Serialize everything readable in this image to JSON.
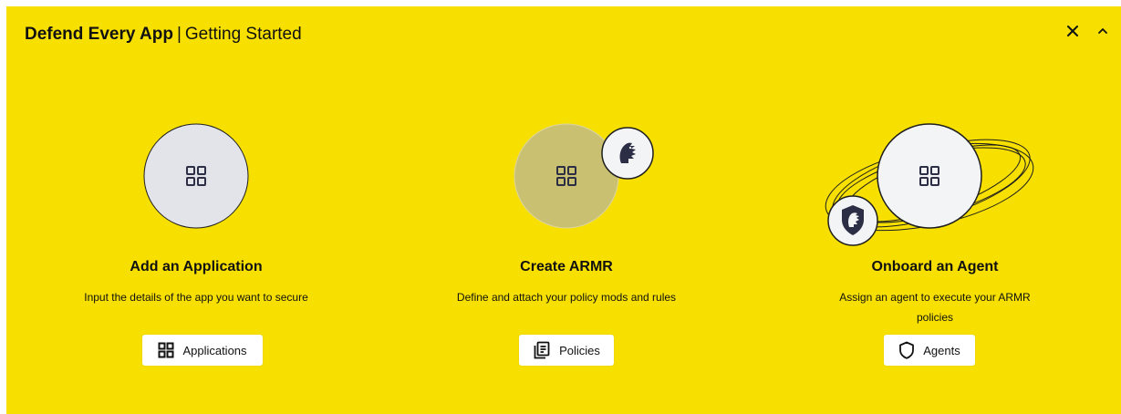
{
  "header": {
    "title_bold": "Defend Every App",
    "separator": "|",
    "title_light": "Getting Started"
  },
  "colors": {
    "panel_bg": "#f7e000",
    "circle_light": "#e2e4ea",
    "circle_olive": "#c9c072",
    "circle_white": "#f3f4f6",
    "dark_icon": "#2b2e45"
  },
  "cards": [
    {
      "title": "Add an Application",
      "description": "Input the details of the app you want to secure",
      "button_label": "Applications",
      "button_icon": "grid-icon"
    },
    {
      "title": "Create ARMR",
      "description": "Define and attach your policy mods and rules",
      "button_label": "Policies",
      "button_icon": "document-list-icon"
    },
    {
      "title": "Onboard an Agent",
      "description": "Assign an agent to execute your ARMR policies",
      "button_label": "Agents",
      "button_icon": "shield-icon"
    }
  ]
}
